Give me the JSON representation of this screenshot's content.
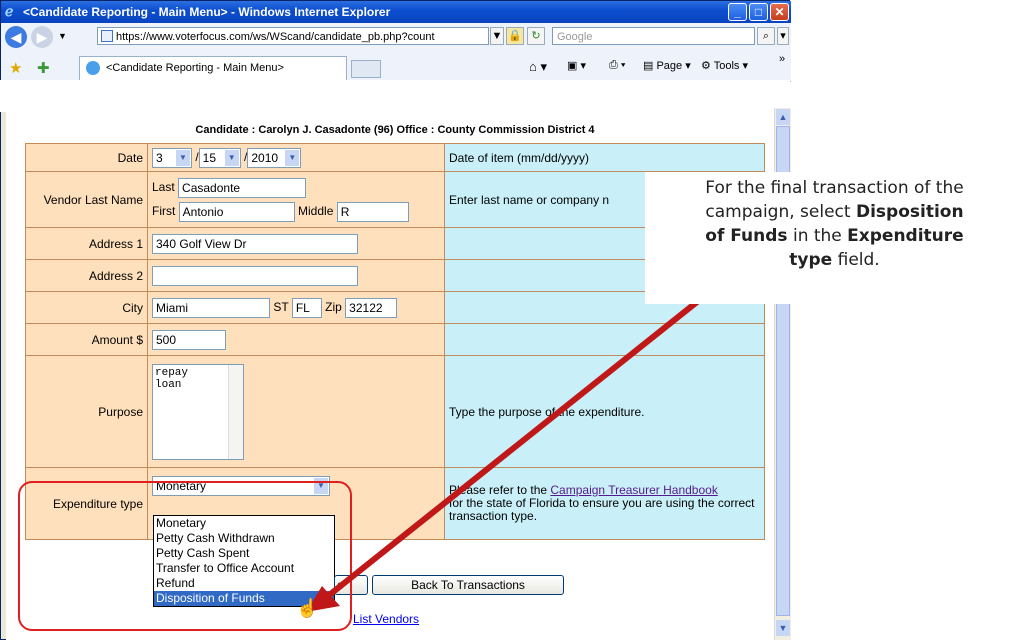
{
  "window": {
    "title": "<Candidate Reporting - Main Menu> - Windows Internet Explorer",
    "url": "https://www.voterfocus.com/ws/WScand/candidate_pb.php?count",
    "search_placeholder": "Google",
    "tab_title": "<Candidate Reporting - Main Menu>",
    "commands": {
      "page": "Page",
      "tools": "Tools"
    }
  },
  "form": {
    "candidate_header": "Candidate : Carolyn J. Casadonte (96) Office : County Commission District 4",
    "date": {
      "label": "Date",
      "month": "3",
      "day": "15",
      "year": "2010",
      "hint": "Date of item (mm/dd/yyyy)"
    },
    "vendor": {
      "label": "Vendor Last Name",
      "last_label": "Last",
      "last_value": "Casadonte",
      "first_label": "First",
      "first_value": "Antonio",
      "middle_label": "Middle",
      "middle_value": "R",
      "hint": "Enter last name or company n"
    },
    "address1": {
      "label": "Address 1",
      "value": "340 Golf View Dr"
    },
    "address2": {
      "label": "Address 2",
      "value": ""
    },
    "city": {
      "label": "City",
      "value": "Miami",
      "st_label": "ST",
      "st_value": "FL",
      "zip_label": "Zip",
      "zip_value": "32122"
    },
    "amount": {
      "label": "Amount $",
      "value": "500"
    },
    "purpose": {
      "label": "Purpose",
      "value": "repay\nloan",
      "hint": "Type the purpose of the expenditure."
    },
    "expenditure": {
      "label": "Expenditure type",
      "selected": "Monetary",
      "options": [
        "Monetary",
        "Petty Cash Withdrawn",
        "Petty Cash Spent",
        "Transfer to Office Account",
        "Refund",
        "Disposition of Funds"
      ],
      "highlighted": "Disposition of Funds",
      "hint_prefix": "Please refer to the ",
      "hint_link": "Campaign Treasurer Handbook",
      "hint_suffix": "for the state of Florida to ensure you are using the correct transaction type."
    },
    "buttons": {
      "save_partial": "e",
      "back": "Back To Transactions"
    },
    "list_vendors_link": "List Vendors"
  },
  "callout": {
    "line1": "For the final transaction of the",
    "line2_pre": "campaign, select ",
    "line2_bold": "Disposition",
    "line3_bold": "of Funds",
    "line3_mid": " in the ",
    "line3_bold2": "Expenditure",
    "line4_bold": "type",
    "line4_post": " field."
  },
  "colors": {
    "annotation": "#e02020",
    "label_bg": "#ffe0bc",
    "hint_bg": "#c9f0f8",
    "selection": "#316ac5"
  }
}
